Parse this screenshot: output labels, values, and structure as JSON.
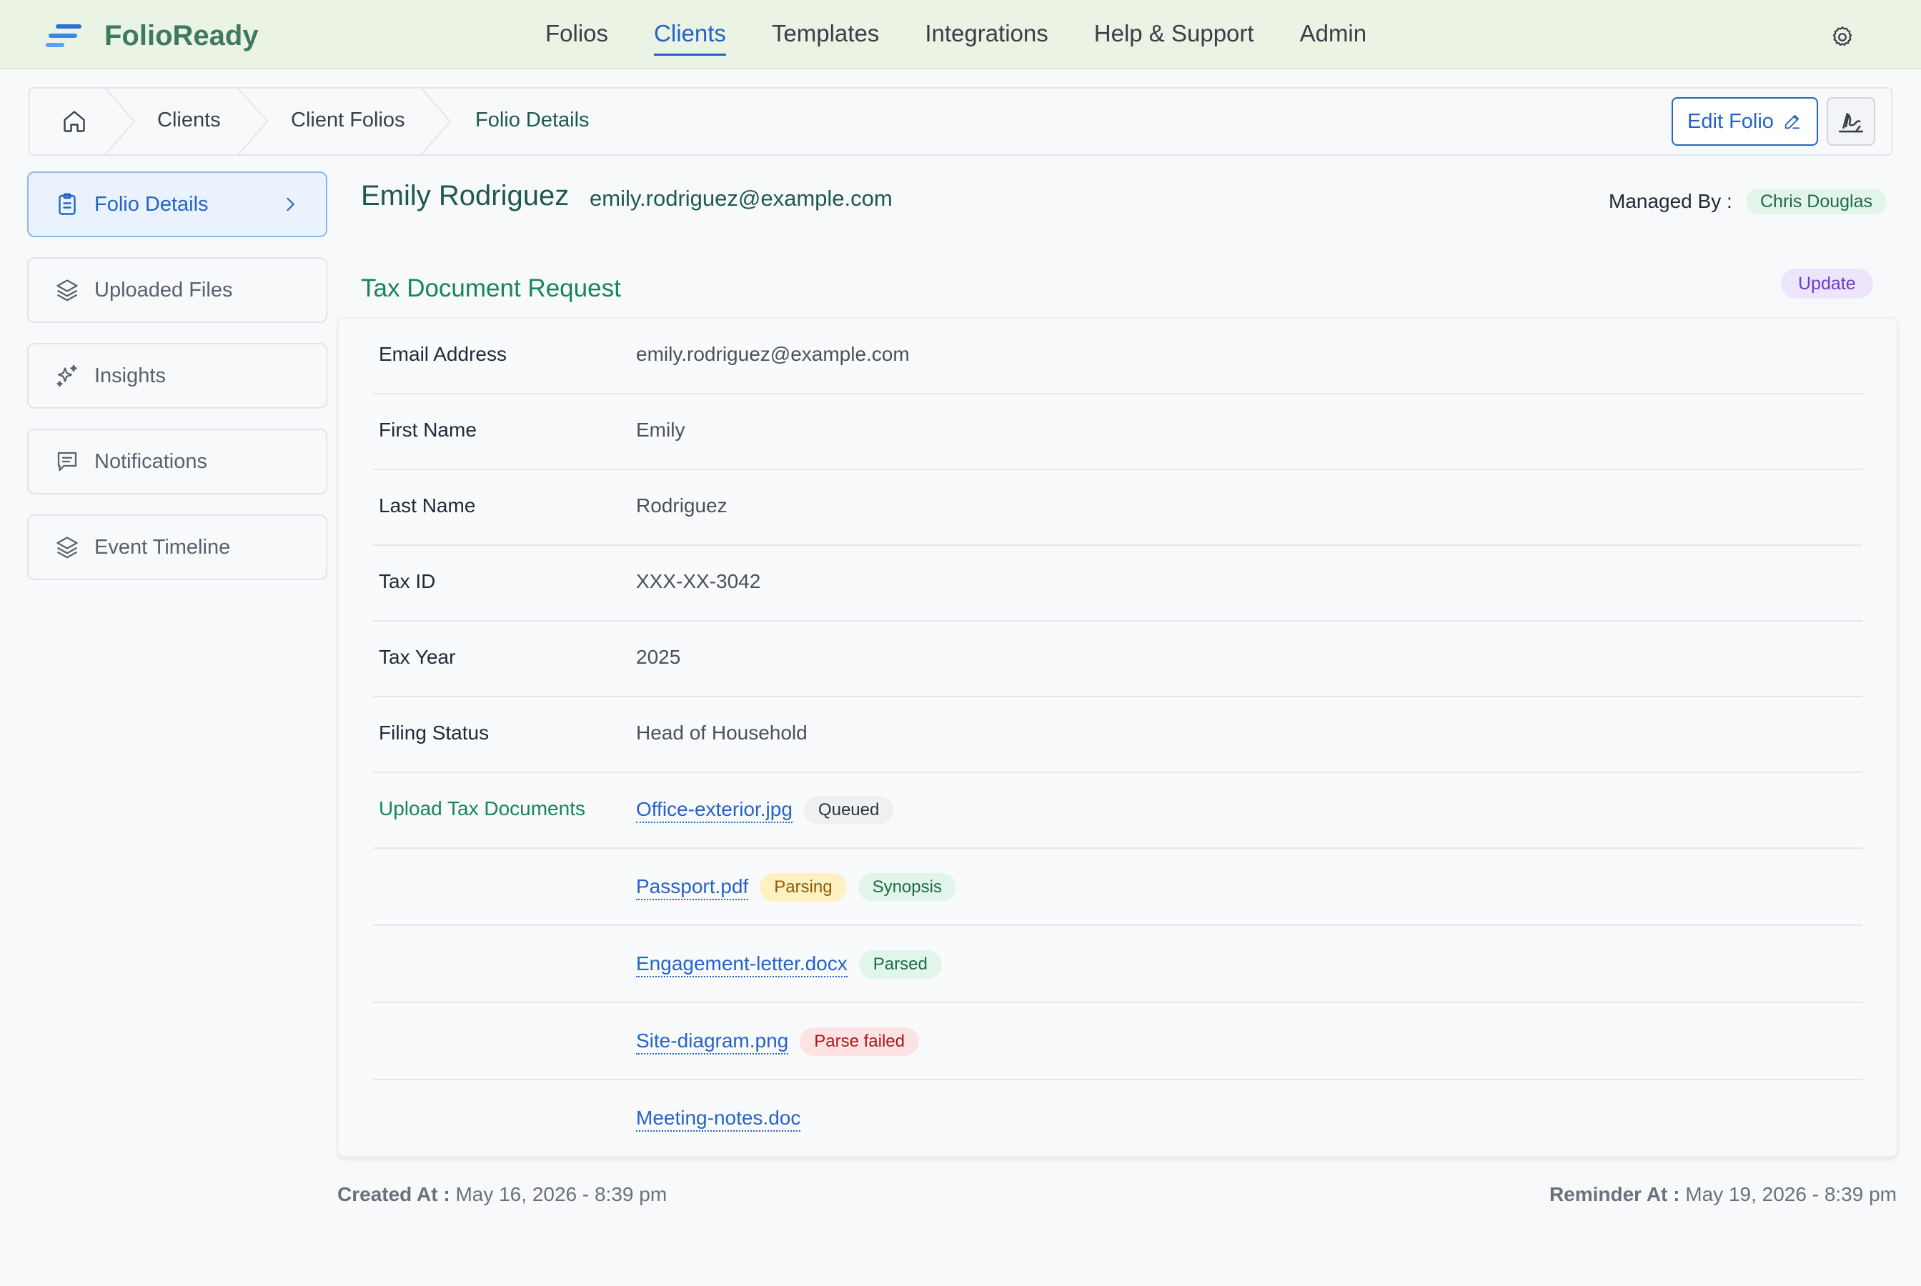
{
  "app": {
    "name": "FolioReady"
  },
  "nav": {
    "items": [
      {
        "label": "Folios"
      },
      {
        "label": "Clients",
        "active": true
      },
      {
        "label": "Templates"
      },
      {
        "label": "Integrations"
      },
      {
        "label": "Help & Support"
      },
      {
        "label": "Admin"
      }
    ]
  },
  "breadcrumb": {
    "items": [
      {
        "label": "Clients"
      },
      {
        "label": "Client Folios"
      },
      {
        "label": "Folio Details",
        "current": true
      }
    ]
  },
  "actions": {
    "edit_label": "Edit Folio"
  },
  "sidebar": {
    "items": [
      {
        "label": "Folio Details",
        "icon": "clipboard-icon",
        "active": true
      },
      {
        "label": "Uploaded Files",
        "icon": "layers-icon"
      },
      {
        "label": "Insights",
        "icon": "sparkles-icon"
      },
      {
        "label": "Notifications",
        "icon": "message-icon"
      },
      {
        "label": "Event Timeline",
        "icon": "layers-icon"
      }
    ]
  },
  "client": {
    "name": "Emily Rodriguez",
    "email": "emily.rodriguez@example.com",
    "managed_by_label": "Managed By :",
    "managed_by": "Chris Douglas"
  },
  "section": {
    "title": "Tax Document Request",
    "update_label": "Update"
  },
  "fields": [
    {
      "label": "Email Address",
      "value": "emily.rodriguez@example.com"
    },
    {
      "label": "First Name",
      "value": "Emily"
    },
    {
      "label": "Last Name",
      "value": "Rodriguez"
    },
    {
      "label": "Tax ID",
      "value": "XXX-XX-3042"
    },
    {
      "label": "Tax Year",
      "value": "2025"
    },
    {
      "label": "Filing Status",
      "value": "Head of Household"
    }
  ],
  "uploads": {
    "label": "Upload Tax Documents",
    "files": [
      {
        "name": "Office-exterior.jpg",
        "tags": [
          {
            "text": "Queued",
            "color": "#eef0f2"
          }
        ]
      },
      {
        "name": "Passport.pdf",
        "tags": [
          {
            "text": "Parsing",
            "color": "#fdf1c2"
          },
          {
            "text": "Synopsis",
            "color": "#e2f5ea"
          }
        ]
      },
      {
        "name": "Engagement-letter.docx",
        "tags": [
          {
            "text": "Parsed",
            "color": "#e2f5ea"
          }
        ]
      },
      {
        "name": "Site-diagram.png",
        "tags": [
          {
            "text": "Parse failed",
            "color": "#fde3e3"
          }
        ]
      },
      {
        "name": "Meeting-notes.doc",
        "tags": []
      }
    ]
  },
  "meta": {
    "created_label": "Created At :",
    "created_value": "May 16, 2026 - 8:39 pm",
    "reminder_label": "Reminder At :",
    "reminder_value": "May 19, 2026 - 8:39 pm"
  },
  "colors": {
    "accent": "#2563c9",
    "brand": "#3e7a5e",
    "header_bg": "#ebf3e4",
    "section_green": "#17855a"
  }
}
